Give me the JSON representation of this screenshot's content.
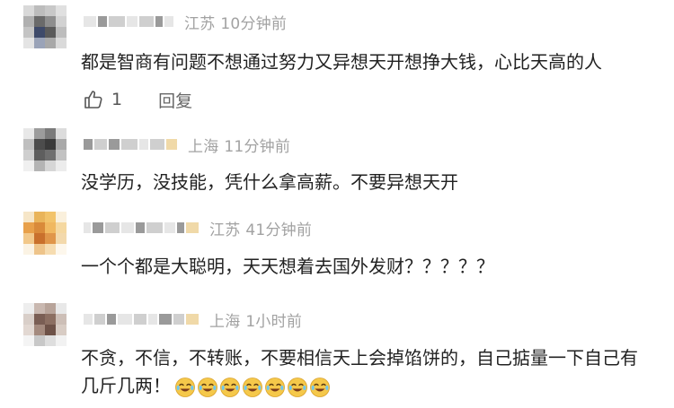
{
  "comments": [
    {
      "location": "江苏",
      "time": "10分钟前",
      "text": "都是智商有问题不想通过努力又异想天开想挣大钱，心比天高的人",
      "like_count": "1",
      "reply_label": "回复"
    },
    {
      "location": "上海",
      "time": "11分钟前",
      "text": "没学历，没技能，凭什么拿高薪。不要异想天开"
    },
    {
      "location": "江苏",
      "time": "41分钟前",
      "text": "一个个都是大聪明，天天想着去国外发财？？？？？"
    },
    {
      "location": "上海",
      "time": "1小时前",
      "text": "不贪，不信，不转账，不要相信天上会掉馅饼的，自己掂量一下自己有几斤几两！",
      "emoji_name": "laughing-crying-emoji",
      "emoji_count": 7
    }
  ],
  "colors": {
    "meta": "#a2a2a2",
    "text": "#222222",
    "emoji": "#f5c84a"
  }
}
